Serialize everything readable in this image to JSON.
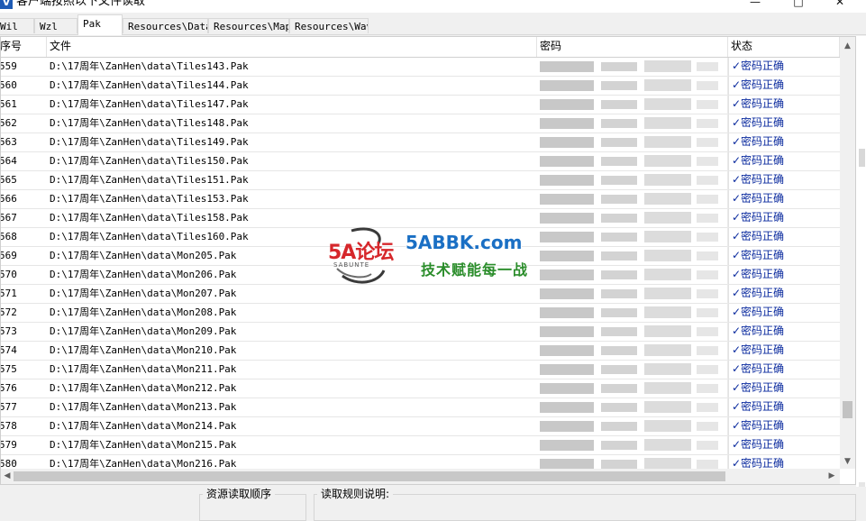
{
  "window": {
    "title": "客户端按照以下文件读取",
    "app_icon": "V",
    "icons": {
      "minimize": "minimize-icon",
      "maximize": "maximize-icon",
      "close": "close-icon"
    }
  },
  "tabs": [
    {
      "label": "Wil",
      "active": false
    },
    {
      "label": "Wzl",
      "active": false
    },
    {
      "label": "Pak",
      "active": true
    },
    {
      "label": "Resources\\Data",
      "active": false
    },
    {
      "label": "Resources\\Map",
      "active": false
    },
    {
      "label": "Resources\\Wav",
      "active": false
    }
  ],
  "table": {
    "columns": {
      "index": "序号",
      "file": "文件",
      "password": "密码",
      "status": "状态"
    },
    "rows": [
      {
        "index": "559",
        "file": "D:\\17周年\\ZanHen\\data\\Tiles143.Pak",
        "status": "✓密码正确"
      },
      {
        "index": "560",
        "file": "D:\\17周年\\ZanHen\\data\\Tiles144.Pak",
        "status": "✓密码正确"
      },
      {
        "index": "561",
        "file": "D:\\17周年\\ZanHen\\data\\Tiles147.Pak",
        "status": "✓密码正确"
      },
      {
        "index": "562",
        "file": "D:\\17周年\\ZanHen\\data\\Tiles148.Pak",
        "status": "✓密码正确"
      },
      {
        "index": "563",
        "file": "D:\\17周年\\ZanHen\\data\\Tiles149.Pak",
        "status": "✓密码正确"
      },
      {
        "index": "564",
        "file": "D:\\17周年\\ZanHen\\data\\Tiles150.Pak",
        "status": "✓密码正确"
      },
      {
        "index": "565",
        "file": "D:\\17周年\\ZanHen\\data\\Tiles151.Pak",
        "status": "✓密码正确"
      },
      {
        "index": "566",
        "file": "D:\\17周年\\ZanHen\\data\\Tiles153.Pak",
        "status": "✓密码正确"
      },
      {
        "index": "567",
        "file": "D:\\17周年\\ZanHen\\data\\Tiles158.Pak",
        "status": "✓密码正确"
      },
      {
        "index": "568",
        "file": "D:\\17周年\\ZanHen\\data\\Tiles160.Pak",
        "status": "✓密码正确"
      },
      {
        "index": "569",
        "file": "D:\\17周年\\ZanHen\\data\\Mon205.Pak",
        "status": "✓密码正确"
      },
      {
        "index": "570",
        "file": "D:\\17周年\\ZanHen\\data\\Mon206.Pak",
        "status": "✓密码正确"
      },
      {
        "index": "571",
        "file": "D:\\17周年\\ZanHen\\data\\Mon207.Pak",
        "status": "✓密码正确"
      },
      {
        "index": "572",
        "file": "D:\\17周年\\ZanHen\\data\\Mon208.Pak",
        "status": "✓密码正确"
      },
      {
        "index": "573",
        "file": "D:\\17周年\\ZanHen\\data\\Mon209.Pak",
        "status": "✓密码正确"
      },
      {
        "index": "574",
        "file": "D:\\17周年\\ZanHen\\data\\Mon210.Pak",
        "status": "✓密码正确"
      },
      {
        "index": "575",
        "file": "D:\\17周年\\ZanHen\\data\\Mon211.Pak",
        "status": "✓密码正确"
      },
      {
        "index": "576",
        "file": "D:\\17周年\\ZanHen\\data\\Mon212.Pak",
        "status": "✓密码正确"
      },
      {
        "index": "577",
        "file": "D:\\17周年\\ZanHen\\data\\Mon213.Pak",
        "status": "✓密码正确"
      },
      {
        "index": "578",
        "file": "D:\\17周年\\ZanHen\\data\\Mon214.Pak",
        "status": "✓密码正确"
      },
      {
        "index": "579",
        "file": "D:\\17周年\\ZanHen\\data\\Mon215.Pak",
        "status": "✓密码正确"
      },
      {
        "index": "580",
        "file": "D:\\17周年\\ZanHen\\data\\Mon216.Pak",
        "status": "✓密码正确"
      }
    ]
  },
  "bottom": {
    "resource_order_label": "资源读取顺序",
    "read_rules_label": "读取规则说明:"
  },
  "watermark": {
    "logo_text": "5A论坛",
    "logo_sub": "SABUNTE",
    "site": "5ABBK.com",
    "slogan": "技术赋能每一战"
  },
  "colors": {
    "status_text": "#0a2a9e",
    "watermark_site": "#1a6fc4",
    "watermark_slogan": "#2b8d2b",
    "logo_red": "#d6272b"
  }
}
